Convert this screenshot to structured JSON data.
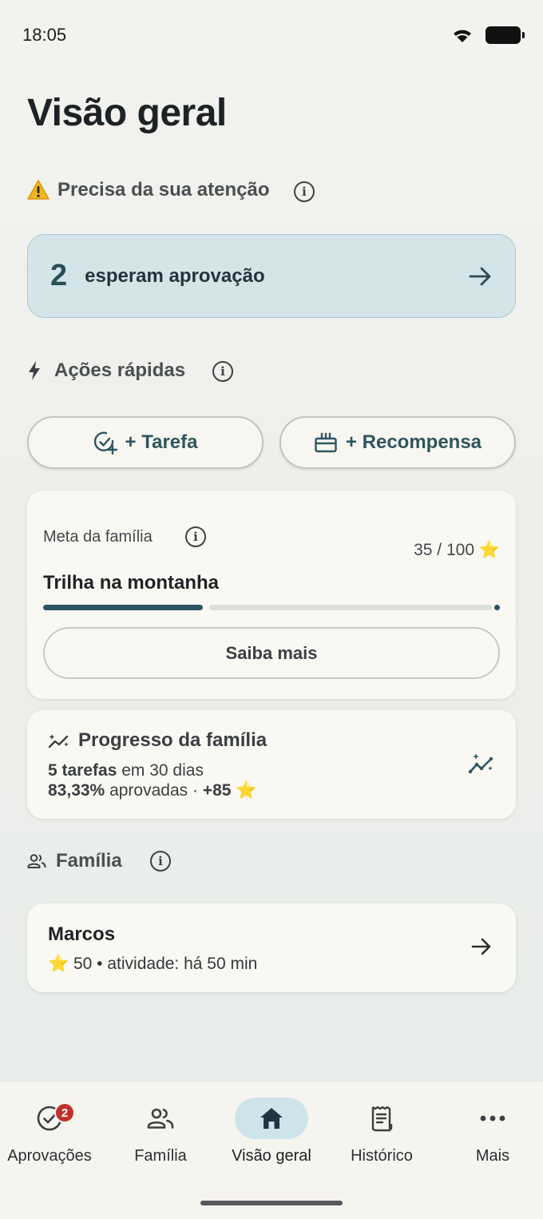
{
  "status_bar": {
    "time": "18:05"
  },
  "page_title": "Visão geral",
  "attention": {
    "title": "Precisa da sua atenção",
    "warning_icon": "warning-icon",
    "approval_count": "2",
    "approval_label": "esperam aprovação"
  },
  "quick_actions": {
    "title": "Ações rápidas",
    "task_label": "+ Tarefa",
    "reward_label": "+ Recompensa"
  },
  "family_goal": {
    "kicker": "Meta da família",
    "points": "35 / 100 ⭐",
    "name": "Trilha na montanha",
    "progress_current": 35,
    "progress_total": 100,
    "learn_more_label": "Saiba mais"
  },
  "family_progress": {
    "title": "Progresso da família",
    "tasks_bold": "5 tarefas",
    "tasks_rest": " em 30 dias",
    "approved_bold": "83,33%",
    "approved_rest": " aprovadas · ",
    "points_bold": "+85",
    "points_star": " ⭐"
  },
  "family": {
    "title": "Família",
    "members": [
      {
        "name": "Marcos",
        "meta": "⭐ 50 • atividade: há 50 min"
      }
    ]
  },
  "bottom_nav": {
    "items": [
      {
        "label": "Aprovações",
        "icon": "check-circle-icon",
        "badge": "2"
      },
      {
        "label": "Família",
        "icon": "people-icon"
      },
      {
        "label": "Visão geral",
        "icon": "home-icon",
        "active": true
      },
      {
        "label": "Histórico",
        "icon": "receipt-icon"
      },
      {
        "label": "Mais",
        "icon": "more-horizontal-icon"
      }
    ]
  },
  "colors": {
    "accent": "#2d5561",
    "approval_bg": "#d3e5e9",
    "badge": "#c2302c"
  }
}
